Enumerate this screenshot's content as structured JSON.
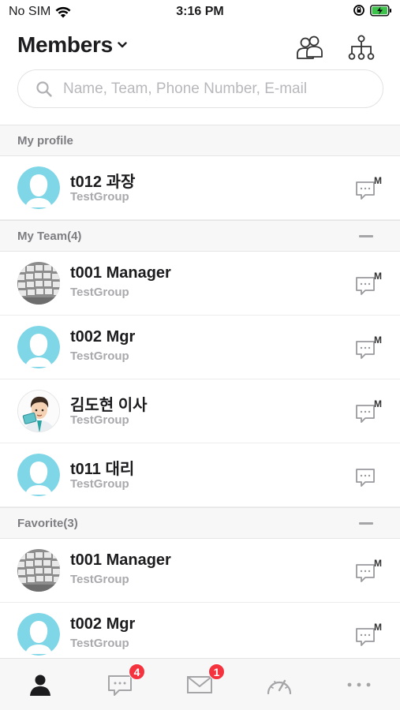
{
  "status_bar": {
    "carrier": "No SIM",
    "time": "3:16 PM"
  },
  "header": {
    "title": "Members"
  },
  "search": {
    "placeholder": "Name, Team, Phone Number, E-mail"
  },
  "sections": [
    {
      "label": "My profile",
      "collapsible": false,
      "members": [
        {
          "name": "t012 과장",
          "group": "TestGroup",
          "avatar": "default",
          "mobile_badge": true
        }
      ]
    },
    {
      "label": "My Team(4)",
      "collapsible": true,
      "members": [
        {
          "name": "t001 Manager",
          "group": "TestGroup",
          "avatar": "keyboard",
          "mobile_badge": true
        },
        {
          "name": "t002 Mgr",
          "group": "TestGroup",
          "avatar": "default",
          "mobile_badge": true
        },
        {
          "name": "김도현 이사",
          "group": "TestGroup",
          "avatar": "cartoon",
          "mobile_badge": true
        },
        {
          "name": "t011 대리",
          "group": "TestGroup",
          "avatar": "default",
          "mobile_badge": false
        }
      ]
    },
    {
      "label": "Favorite(3)",
      "collapsible": true,
      "members": [
        {
          "name": "t001 Manager",
          "group": "TestGroup",
          "avatar": "keyboard",
          "mobile_badge": true
        },
        {
          "name": "t002 Mgr",
          "group": "TestGroup",
          "avatar": "default",
          "mobile_badge": true
        }
      ]
    }
  ],
  "message_badge_letter": "M",
  "tabbar": {
    "tabs": [
      {
        "icon": "person-icon",
        "active": true
      },
      {
        "icon": "chat-icon",
        "badge": "4"
      },
      {
        "icon": "mail-icon",
        "badge": "1"
      },
      {
        "icon": "speedometer-icon"
      },
      {
        "icon": "more-icon"
      }
    ]
  },
  "colors": {
    "accent_avatar": "#7fd6e6",
    "badge": "#f5333f",
    "text": "#1c1c1e",
    "muted": "#a9a9ad"
  }
}
